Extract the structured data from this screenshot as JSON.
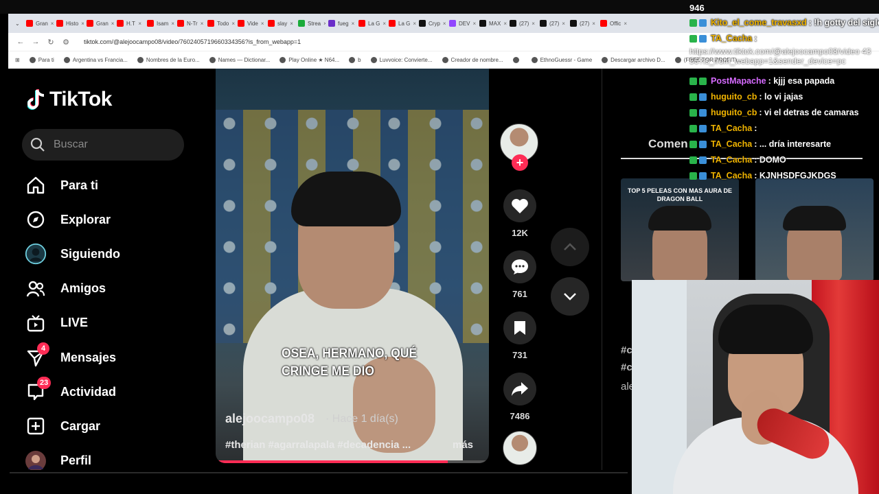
{
  "browser": {
    "tabs": [
      {
        "label": "Gran",
        "color": "#ff0000"
      },
      {
        "label": "Histo",
        "color": "#ff0000"
      },
      {
        "label": "Gran",
        "color": "#ff0000"
      },
      {
        "label": "H.T",
        "color": "#ff0000"
      },
      {
        "label": "Isam",
        "color": "#ff0000"
      },
      {
        "label": "N-Tr",
        "color": "#ff0000"
      },
      {
        "label": "Todo",
        "color": "#ff0000"
      },
      {
        "label": "Vide",
        "color": "#ff0000"
      },
      {
        "label": "slay",
        "color": "#ff0000"
      },
      {
        "label": "Strea",
        "color": "#1aab3a"
      },
      {
        "label": "fueg",
        "color": "#6b2ec9"
      },
      {
        "label": "La G",
        "color": "#ff0000"
      },
      {
        "label": "La G",
        "color": "#ff0000"
      },
      {
        "label": "Cryp",
        "color": "#111111"
      },
      {
        "label": "DEV",
        "color": "#9146ff"
      },
      {
        "label": "MAX",
        "color": "#111111"
      },
      {
        "label": "(27)",
        "color": "#111111"
      },
      {
        "label": "(27)",
        "color": "#111111"
      },
      {
        "label": "(27)",
        "color": "#111111"
      },
      {
        "label": "Offic",
        "color": "#ff0000"
      }
    ],
    "url": "tiktok.com/@alejoocampo08/video/7602405719660334356?is_from_webapp=1",
    "bookmarks": [
      "Para ti",
      "Argentina vs Francia...",
      "Nombres de la Euro...",
      "Names — Dictionar...",
      "Play Online ★ N64...",
      "b",
      "Luvvoice: Convierte...",
      "Creador de nombre...",
      "",
      "EthnoGuessr - Game",
      "Descargar archivo D...",
      "(FREE FOR PROFIT)..."
    ],
    "bookmarks_right": "Todos los marcadores"
  },
  "sidebar": {
    "logo": "TikTok",
    "search_placeholder": "Buscar",
    "items": [
      {
        "label": "Para ti",
        "icon": "home-icon"
      },
      {
        "label": "Explorar",
        "icon": "compass-icon"
      },
      {
        "label": "Siguiendo",
        "icon": "following-avatar-icon"
      },
      {
        "label": "Amigos",
        "icon": "friends-icon"
      },
      {
        "label": "LIVE",
        "icon": "live-tv-icon"
      },
      {
        "label": "Mensajes",
        "icon": "messages-icon",
        "badge": "4"
      },
      {
        "label": "Actividad",
        "icon": "activity-icon",
        "badge": "23"
      },
      {
        "label": "Cargar",
        "icon": "upload-plus-icon"
      },
      {
        "label": "Perfil",
        "icon": "profile-avatar-icon"
      }
    ]
  },
  "video": {
    "caption": "OSEA, HERMANO, QUÉ CRINGE ME DIO",
    "author": "alejoocampo08",
    "time": "· Hace 1 día(s)",
    "tags": "#therian #agarralapala #decadencia ...",
    "more": "más",
    "progress": 0.85
  },
  "actions": {
    "likes": "12K",
    "comments": "761",
    "saves": "731",
    "shares": "7486"
  },
  "side": {
    "comments_title": "Comen",
    "thumb_caption": "TOP 5 PELEAS CON MAS AURA DE DRAGON BALL",
    "frag1": "#c",
    "frag2": "#c",
    "frag3": "ale"
  },
  "chat": {
    "viewers": "946",
    "messages": [
      {
        "user": "Kito_el_come_travasxd",
        "text": ": !h gotty del siglo",
        "color": "#f0b400"
      },
      {
        "user": "TA_Cacha",
        "text": ":",
        "color": "#f0b400"
      },
      {
        "user": "PostMapache",
        "text": ": kjjj esa papada",
        "color": "#d66bff"
      },
      {
        "user": "huguito_cb",
        "text": ": lo vi jajas",
        "color": "#f0b400"
      },
      {
        "user": "huguito_cb",
        "text": ": vi el detras de camaras",
        "color": "#f0b400"
      },
      {
        "user": "TA_Cacha",
        "text": ":",
        "color": "#f0b400"
      },
      {
        "user": "TA_Cacha",
        "text": ": ... dría interesarte",
        "color": "#f0b400"
      },
      {
        "user": "TA_Cacha",
        "text": ": DOMO",
        "color": "#f0b400"
      },
      {
        "user": "TA_Cacha",
        "text": ": KJNHSDFGJKDGS",
        "color": "#f0b400"
      }
    ],
    "url_text": "https://www.tiktok.com/@alejoocampo08/video 4356?is_from_webapp=1&sender_device=pc"
  },
  "colors": {
    "accent": "#fe2c55",
    "panel": "#1f1f1f"
  }
}
